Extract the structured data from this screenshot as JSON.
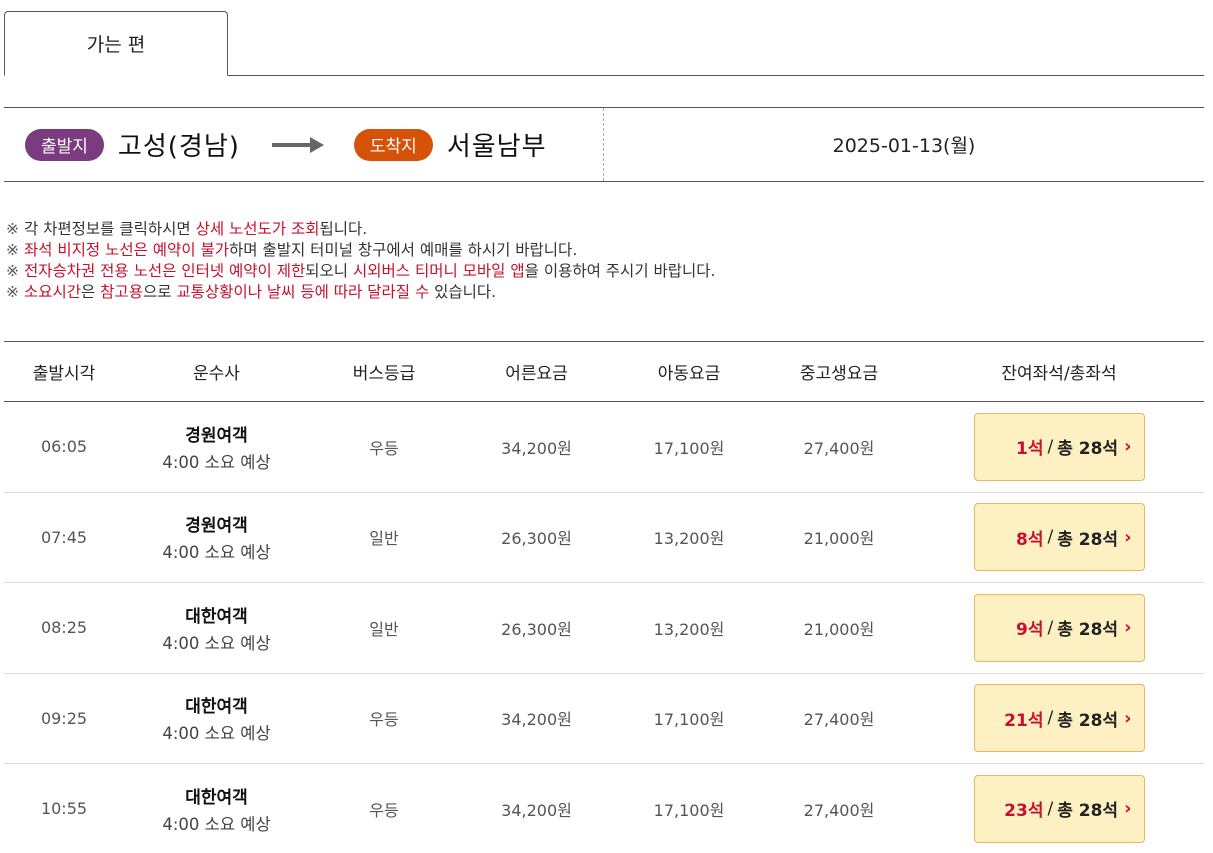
{
  "tab": {
    "label": "가는 편"
  },
  "route": {
    "departure_badge": "출발지",
    "departure": "고성(경남)",
    "arrival_badge": "도착지",
    "arrival": "서울남부",
    "date": "2025-01-13(월)"
  },
  "notices": {
    "mark": "※",
    "n1_a": "각 차편정보를 클릭하시면 ",
    "n1_b": "상세 노선도가 조회",
    "n1_c": "됩니다.",
    "n2_a": "좌석 비지정 노선은 예약이 불가",
    "n2_b": "하며 출발지 터미널 창구에서 예매를 하시기 바랍니다.",
    "n3_a": "전자승차권 전용 노선은 인터넷 예약이 제한",
    "n3_b": "되오니 ",
    "n3_c": "시외버스 티머니 모바일 앱",
    "n3_d": "을 이용하여 주시기 바랍니다.",
    "n4_a": "소요시간",
    "n4_b": "은 ",
    "n4_c": "참고용",
    "n4_d": "으로 ",
    "n4_e": "교통상황이나 날씨 등에 따라 달라질 수",
    "n4_f": " 있습니다."
  },
  "table": {
    "headers": [
      "출발시각",
      "운수사",
      "버스등급",
      "어른요금",
      "아동요금",
      "중고생요금",
      "잔여좌석/총좌석"
    ],
    "rows": [
      {
        "time": "06:05",
        "company": "경원여객",
        "duration": "4:00 소요 예상",
        "grade": "우등",
        "adult": "34,200원",
        "child": "17,100원",
        "teen": "27,400원",
        "remain": "1석",
        "total": "총 28석"
      },
      {
        "time": "07:45",
        "company": "경원여객",
        "duration": "4:00 소요 예상",
        "grade": "일반",
        "adult": "26,300원",
        "child": "13,200원",
        "teen": "21,000원",
        "remain": "8석",
        "total": "총 28석"
      },
      {
        "time": "08:25",
        "company": "대한여객",
        "duration": "4:00 소요 예상",
        "grade": "일반",
        "adult": "26,300원",
        "child": "13,200원",
        "teen": "21,000원",
        "remain": "9석",
        "total": "총 28석"
      },
      {
        "time": "09:25",
        "company": "대한여객",
        "duration": "4:00 소요 예상",
        "grade": "우등",
        "adult": "34,200원",
        "child": "17,100원",
        "teen": "27,400원",
        "remain": "21석",
        "total": "총 28석"
      },
      {
        "time": "10:55",
        "company": "대한여객",
        "duration": "4:00 소요 예상",
        "grade": "우등",
        "adult": "34,200원",
        "child": "17,100원",
        "teen": "27,400원",
        "remain": "23석",
        "total": "총 28석"
      }
    ],
    "slash": "/",
    "chevron": "›"
  },
  "colors": {
    "departure_badge": "#7b3b7f",
    "arrival_badge": "#d45309",
    "highlight_red": "#c8102e",
    "seat_button_bg": "#fdf0c3",
    "seat_button_border": "#f0b35f"
  },
  "icons": {
    "route_arrow": "right-arrow-icon",
    "seat_chevron": "chevron-right-icon"
  }
}
